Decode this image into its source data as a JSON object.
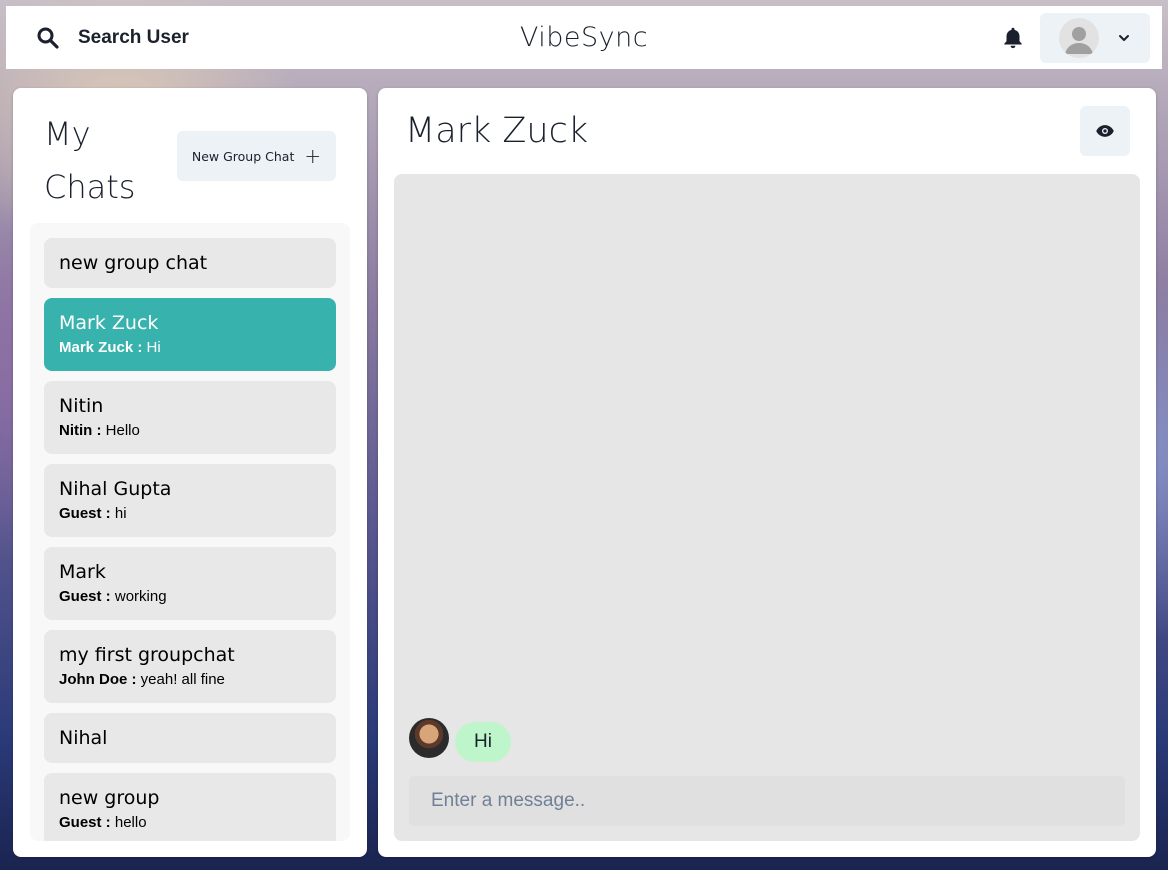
{
  "header": {
    "search_label": "Search User",
    "app_title": "VibeSync"
  },
  "sidebar": {
    "title": "My Chats",
    "new_group_label": "New Group Chat",
    "chats": [
      {
        "name": "new group chat",
        "sender": "",
        "message": "",
        "active": false
      },
      {
        "name": "Mark Zuck",
        "sender": "Mark Zuck :",
        "message": "Hi",
        "active": true
      },
      {
        "name": "Nitin",
        "sender": "Nitin :",
        "message": "Hello",
        "active": false
      },
      {
        "name": "Nihal Gupta",
        "sender": "Guest :",
        "message": "hi",
        "active": false
      },
      {
        "name": "Mark",
        "sender": "Guest :",
        "message": "working",
        "active": false
      },
      {
        "name": "my first groupchat",
        "sender": "John Doe :",
        "message": "yeah! all fine",
        "active": false
      },
      {
        "name": "Nihal",
        "sender": "",
        "message": "",
        "active": false
      },
      {
        "name": "new group",
        "sender": "Guest :",
        "message": "hello",
        "active": false
      }
    ]
  },
  "chat": {
    "title": "Mark Zuck",
    "messages": [
      {
        "text": "Hi",
        "from_other": true
      }
    ],
    "input_placeholder": "Enter a message..",
    "input_value": ""
  },
  "icons": {
    "search": "search-icon",
    "bell": "bell-icon",
    "avatar": "user-avatar-icon",
    "chevron": "chevron-down-icon",
    "plus": "plus-icon",
    "eye": "eye-icon"
  },
  "colors": {
    "accent_teal": "#38b2ac",
    "message_bubble": "#bef5cb",
    "button_bg": "#edf2f7",
    "chat_item_bg": "#e8e8e8"
  }
}
